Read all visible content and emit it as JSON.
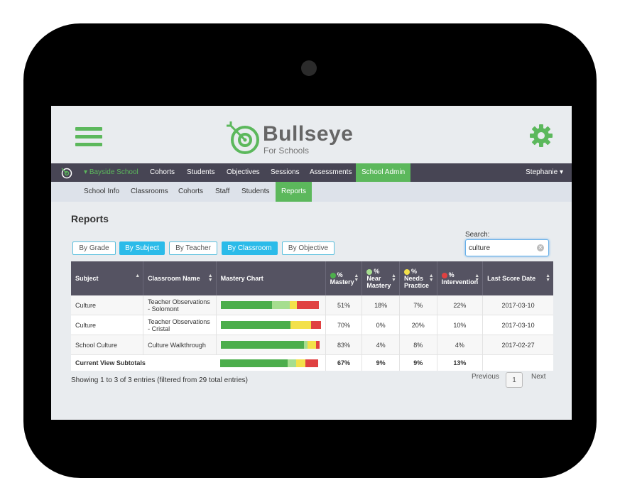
{
  "app": {
    "logo_title": "Bullseye",
    "logo_subtitle": "For Schools"
  },
  "main_nav": {
    "school": "Bayside School",
    "items": [
      "Cohorts",
      "Students",
      "Objectives",
      "Sessions",
      "Assessments",
      "School Admin"
    ],
    "active": "School Admin",
    "user": "Stephanie"
  },
  "sub_nav": {
    "items": [
      "School Info",
      "Classrooms",
      "Cohorts",
      "Staff",
      "Students",
      "Reports"
    ],
    "active": "Reports"
  },
  "page_title": "Reports",
  "filters": {
    "buttons": [
      "By Grade",
      "By Subject",
      "By Teacher",
      "By Classroom",
      "By Objective"
    ],
    "active": [
      "By Subject",
      "By Classroom"
    ]
  },
  "search": {
    "label": "Search:",
    "value": "culture"
  },
  "table": {
    "headers": {
      "subject": "Subject",
      "classroom": "Classroom Name",
      "chart": "Mastery Chart",
      "mastery": "% Mastery",
      "near": "% Near Mastery",
      "needs": "% Needs Practice",
      "intervention": "% Intervention",
      "date": "Last Score Date"
    },
    "rows": [
      {
        "subject": "Culture",
        "classroom": "Teacher Observations - Solomont",
        "mastery": "51%",
        "near": "18%",
        "needs": "7%",
        "intervention": "22%",
        "date": "2017-03-10",
        "bar": [
          51,
          18,
          7,
          22
        ]
      },
      {
        "subject": "Culture",
        "classroom": "Teacher Observations - Cristal",
        "mastery": "70%",
        "near": "0%",
        "needs": "20%",
        "intervention": "10%",
        "date": "2017-03-10",
        "bar": [
          70,
          0,
          20,
          10
        ]
      },
      {
        "subject": "School Culture",
        "classroom": "Culture Walkthrough",
        "mastery": "83%",
        "near": "4%",
        "needs": "8%",
        "intervention": "4%",
        "date": "2017-02-27",
        "bar": [
          83,
          4,
          8,
          4
        ]
      }
    ],
    "total": {
      "label": "Current View Subtotals",
      "mastery": "67%",
      "near": "9%",
      "needs": "9%",
      "intervention": "13%",
      "bar": [
        67,
        9,
        9,
        13
      ]
    }
  },
  "status_colors": {
    "mastery": "#4cae4c",
    "near": "#a6de8f",
    "needs": "#f3e14a",
    "intervention": "#e04141"
  },
  "footer": {
    "info": "Showing 1 to 3 of 3 entries (filtered from 29 total entries)",
    "previous": "Previous",
    "page": "1",
    "next": "Next"
  }
}
